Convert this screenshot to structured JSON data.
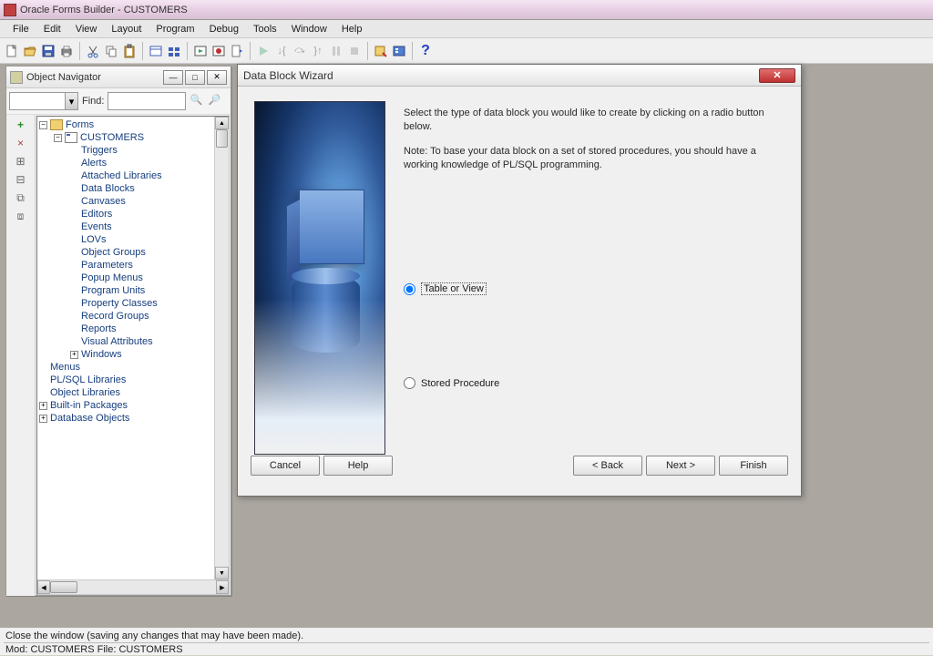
{
  "titlebar": {
    "text": "Oracle Forms Builder - CUSTOMERS"
  },
  "menubar": [
    "File",
    "Edit",
    "View",
    "Layout",
    "Program",
    "Debug",
    "Tools",
    "Window",
    "Help"
  ],
  "navigator": {
    "title": "Object Navigator",
    "find_label": "Find:",
    "tree": {
      "forms": "Forms",
      "customers": "CUSTOMERS",
      "children": [
        "Triggers",
        "Alerts",
        "Attached Libraries",
        "Data Blocks",
        "Canvases",
        "Editors",
        "Events",
        "LOVs",
        "Object Groups",
        "Parameters",
        "Popup Menus",
        "Program Units",
        "Property Classes",
        "Record Groups",
        "Reports",
        "Visual Attributes",
        "Windows"
      ],
      "menus": "Menus",
      "pl": "PL/SQL Libraries",
      "objlib": "Object Libraries",
      "builtin": "Built-in Packages",
      "dbobj": "Database Objects"
    }
  },
  "wizard": {
    "title": "Data Block Wizard",
    "p1": "Select the type of data block you would like to create by clicking on a radio button below.",
    "p2": "Note: To base your data block on a set of stored procedures, you should have a working knowledge of PL/SQL programming.",
    "opt1": "Table or View",
    "opt2": "Stored Procedure",
    "buttons": {
      "cancel": "Cancel",
      "help": "Help",
      "back": "< Back",
      "next": "Next >",
      "finish": "Finish"
    }
  },
  "status": {
    "hint": "Close the window (saving any changes that may have been made).",
    "mod": "Mod: CUSTOMERS File: CUSTOMERS"
  }
}
